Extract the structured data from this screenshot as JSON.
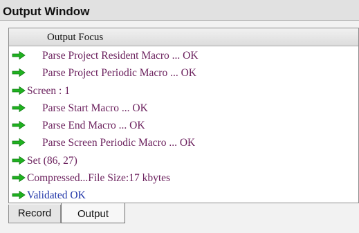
{
  "window": {
    "title": "Output Window"
  },
  "output_list": {
    "header": "Output Focus",
    "rows": [
      {
        "text": "Parse Project Resident Macro ... OK",
        "indent": true,
        "color": "#6a1f5c"
      },
      {
        "text": "Parse Project Periodic Macro ... OK",
        "indent": true,
        "color": "#6a1f5c"
      },
      {
        "text": "Screen : 1",
        "indent": false,
        "color": "#6a1f5c"
      },
      {
        "text": "Parse Start Macro ... OK",
        "indent": true,
        "color": "#6a1f5c"
      },
      {
        "text": "Parse End Macro ... OK",
        "indent": true,
        "color": "#6a1f5c"
      },
      {
        "text": "Parse Screen Periodic Macro ... OK",
        "indent": true,
        "color": "#6a1f5c"
      },
      {
        "text": "Set (86, 27)",
        "indent": false,
        "color": "#6a1f5c"
      },
      {
        "text": "Compressed...File Size:17 kbytes",
        "indent": false,
        "color": "#6a1f5c"
      },
      {
        "text": "Validated OK",
        "indent": false,
        "color": "#2035a8"
      }
    ],
    "row_icon": "green-right-arrow-icon",
    "arrow_color": "#1fb21f"
  },
  "tabs": [
    {
      "label": "Record",
      "active": false
    },
    {
      "label": "Output",
      "active": true
    }
  ]
}
